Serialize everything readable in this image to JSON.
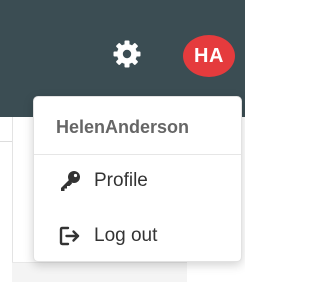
{
  "header": {
    "background_color": "#3b4d53",
    "settings_icon": "gear-icon",
    "avatar": {
      "initials": "HA",
      "color": "#e53b3d"
    }
  },
  "user_menu": {
    "username": "HelenAnderson",
    "items": [
      {
        "label": "Profile",
        "icon": "key-icon"
      },
      {
        "label": "Log out",
        "icon": "logout-icon"
      }
    ]
  }
}
